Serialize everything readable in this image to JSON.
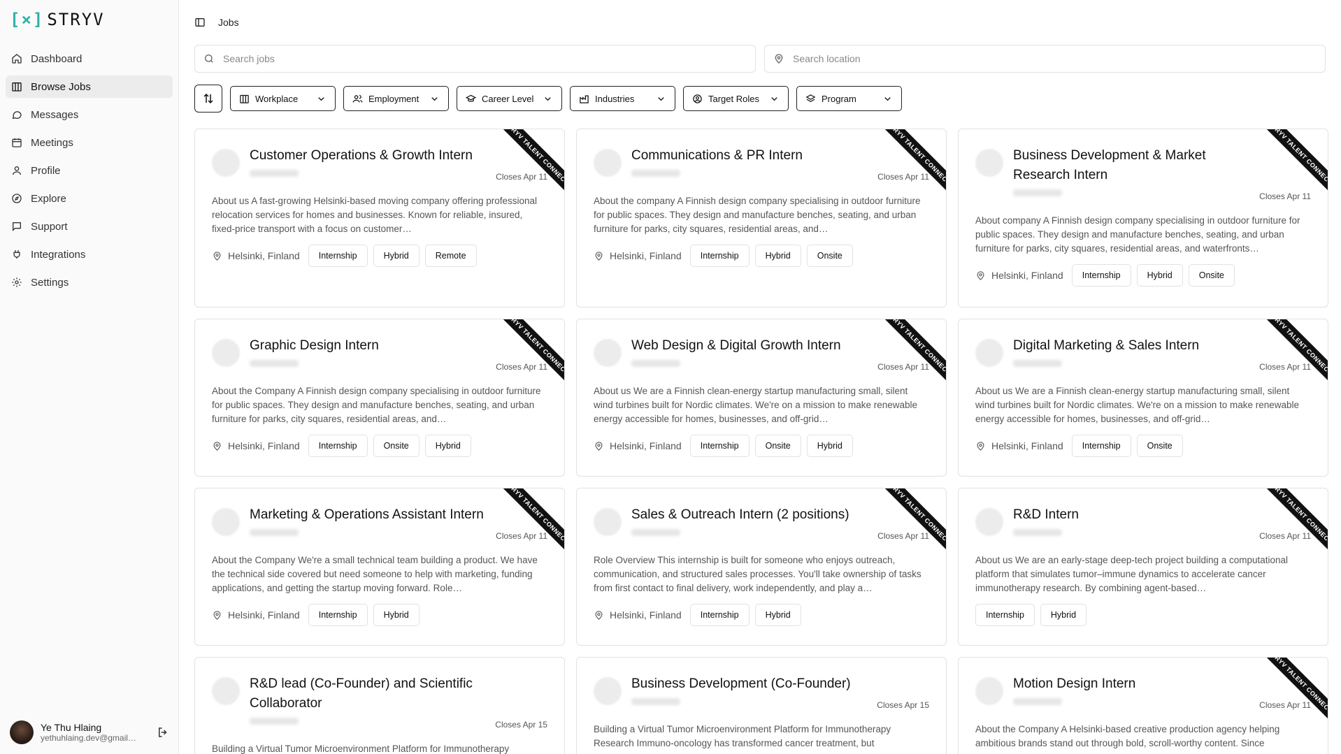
{
  "app": {
    "logo_mark": "[×]",
    "logo_text": "STRYV"
  },
  "sidebar": {
    "items": [
      {
        "label": "Dashboard",
        "icon": "home-icon"
      },
      {
        "label": "Browse Jobs",
        "icon": "building-icon",
        "active": true
      },
      {
        "label": "Messages",
        "icon": "message-icon"
      },
      {
        "label": "Meetings",
        "icon": "calendar-icon"
      },
      {
        "label": "Profile",
        "icon": "user-icon"
      },
      {
        "label": "Explore",
        "icon": "compass-icon"
      },
      {
        "label": "Support",
        "icon": "chat-icon"
      },
      {
        "label": "Integrations",
        "icon": "plug-icon"
      },
      {
        "label": "Settings",
        "icon": "gear-icon"
      }
    ],
    "user": {
      "name": "Ye Thu Hlaing",
      "email": "yethuhlaing.dev@gmail.com"
    }
  },
  "header": {
    "title": "Jobs"
  },
  "search": {
    "jobs_placeholder": "Search jobs",
    "location_placeholder": "Search location"
  },
  "filters": [
    "Workplace",
    "Employment",
    "Career Level",
    "Industries",
    "Target Roles",
    "Program"
  ],
  "ribbon_text": "STRYV TALENT CONNECT",
  "jobs": [
    {
      "title": "Customer Operations & Growth Intern",
      "closes": "Closes Apr 11",
      "desc": "About us A fast-growing Helsinki-based moving company offering professional relocation services for homes and businesses. Known for reliable, insured, fixed-price transport with a focus on customer…",
      "location": "Helsinki, Finland",
      "tags": [
        "Internship",
        "Hybrid",
        "Remote"
      ]
    },
    {
      "title": "Communications & PR Intern",
      "closes": "Closes Apr 11",
      "desc": "About the company A Finnish design company specialising in outdoor furniture for public spaces. They design and manufacture benches, seating, and urban furniture for parks, city squares, residential areas, and…",
      "location": "Helsinki, Finland",
      "tags": [
        "Internship",
        "Hybrid",
        "Onsite"
      ]
    },
    {
      "title": "Business Development & Market Research Intern",
      "closes": "Closes Apr 11",
      "desc": "About company A Finnish design company specialising in outdoor furniture for public spaces. They design and manufacture benches, seating, and urban furniture for parks, city squares, residential areas, and waterfronts…",
      "location": "Helsinki, Finland",
      "tags": [
        "Internship",
        "Hybrid",
        "Onsite"
      ]
    },
    {
      "title": "Graphic Design Intern",
      "closes": "Closes Apr 11",
      "desc": "About the Company A Finnish design company specialising in outdoor furniture for public spaces. They design and manufacture benches, seating, and urban furniture for parks, city squares, residential areas, and…",
      "location": "Helsinki, Finland",
      "tags": [
        "Internship",
        "Onsite",
        "Hybrid"
      ]
    },
    {
      "title": "Web Design & Digital Growth Intern",
      "closes": "Closes Apr 11",
      "desc": "About us We are a Finnish clean-energy startup manufacturing small, silent wind turbines built for Nordic climates. We're on a mission to make renewable energy accessible for homes, businesses, and off-grid…",
      "location": "Helsinki, Finland",
      "tags": [
        "Internship",
        "Onsite",
        "Hybrid"
      ]
    },
    {
      "title": "Digital Marketing & Sales Intern",
      "closes": "Closes Apr 11",
      "desc": "About us We are a Finnish clean-energy startup manufacturing small, silent wind turbines built for Nordic climates. We're on a mission to make renewable energy accessible for homes, businesses, and off-grid…",
      "location": "Helsinki, Finland",
      "tags": [
        "Internship",
        "Onsite"
      ]
    },
    {
      "title": "Marketing & Operations Assistant Intern",
      "closes": "Closes Apr 11",
      "desc": "About the Company We're a small technical team building a product. We have the technical side covered but need someone to help with marketing, funding applications, and getting the startup moving forward. Role…",
      "location": "Helsinki, Finland",
      "tags": [
        "Internship",
        "Hybrid"
      ]
    },
    {
      "title": "Sales & Outreach Intern (2 positions)",
      "closes": "Closes Apr 11",
      "desc": "Role Overview This internship is built for someone who enjoys outreach, communication, and structured sales processes. You'll take ownership of tasks from first contact to final delivery, work independently, and play a…",
      "location": "Helsinki, Finland",
      "tags": [
        "Internship",
        "Hybrid"
      ]
    },
    {
      "title": "R&D Intern",
      "closes": "Closes Apr 11",
      "desc": "About us We are an early-stage deep-tech project building a computational platform that simulates tumor–immune dynamics to accelerate cancer immunotherapy research. By combining agent-based…",
      "location": "",
      "tags": [
        "Internship",
        "Hybrid"
      ]
    },
    {
      "title": "R&D lead (Co-Founder) and Scientific Collaborator",
      "closes": "Closes Apr 15",
      "desc": "Building a Virtual Tumor Microenvironment Platform for Immunotherapy Research Immuno-oncology has transformed cancer treatment, but",
      "location": "",
      "tags": []
    },
    {
      "title": "Business Development (Co-Founder)",
      "closes": "Closes Apr 15",
      "desc": "Building a Virtual Tumor Microenvironment Platform for Immunotherapy Research Immuno-oncology has transformed cancer treatment, but",
      "location": "",
      "tags": []
    },
    {
      "title": "Motion Design Intern",
      "closes": "Closes Apr 11",
      "desc": "About the Company A Helsinki-based creative production agency helping ambitious brands stand out through bold, scroll-worthy content. Since",
      "location": "",
      "tags": []
    }
  ]
}
